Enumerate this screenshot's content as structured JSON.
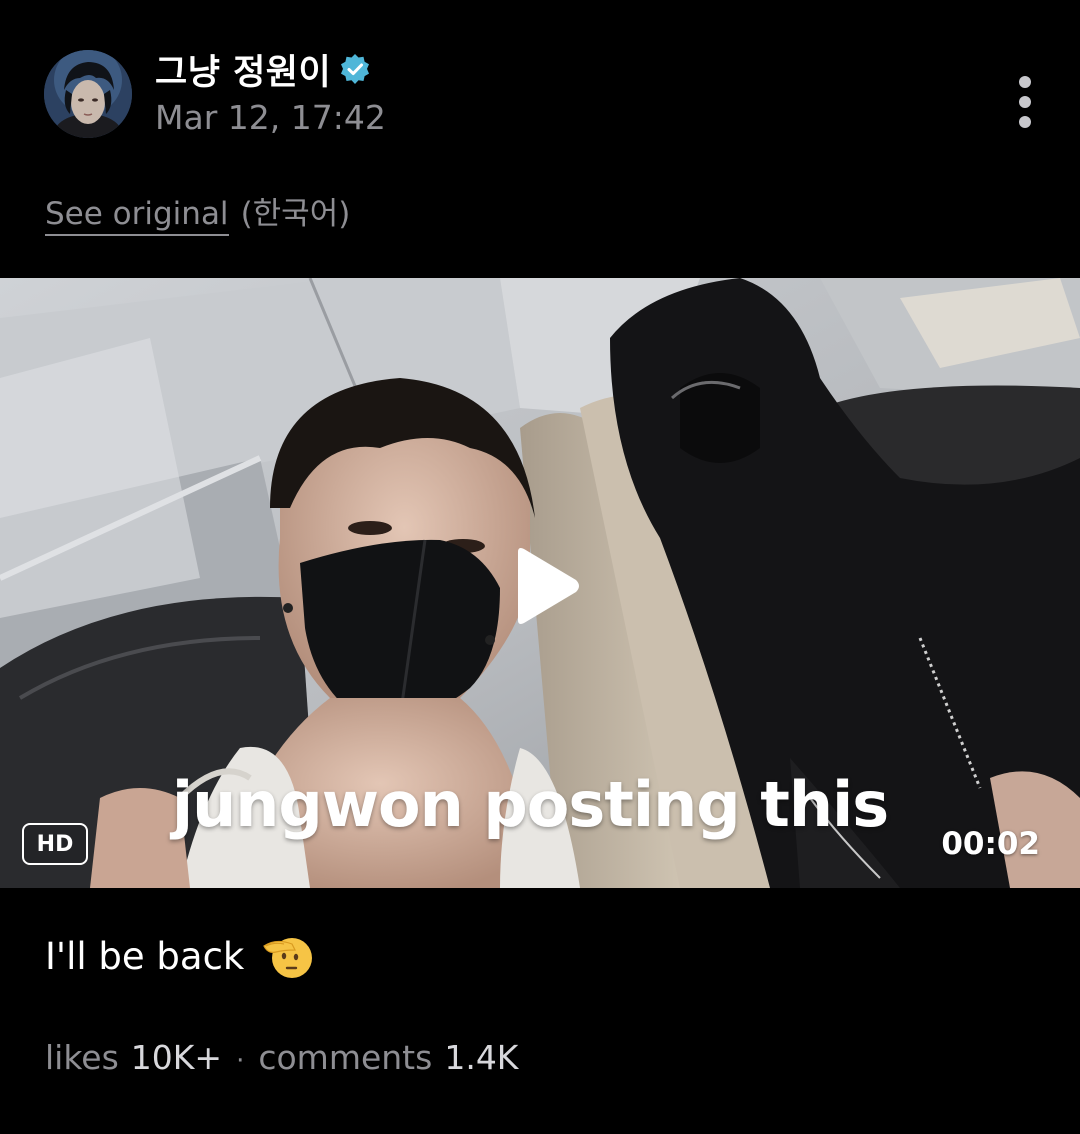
{
  "post": {
    "author_name": "그냥 정원이",
    "verified_icon": "verified-badge-icon",
    "timestamp": "Mar 12, 17:42",
    "more_icon": "more-vertical-icon"
  },
  "translation": {
    "see_original_label": "See original",
    "language_label": "(한국어)"
  },
  "video": {
    "overlay_text": "jungwon posting this",
    "quality_badge": "HD",
    "duration": "00:02",
    "play_icon": "play-icon"
  },
  "caption": {
    "text": "I'll be back",
    "emoji_icon": "saluting-face-icon"
  },
  "stats": {
    "likes_label": "likes",
    "likes_value": "10K+",
    "separator": "·",
    "comments_label": "comments",
    "comments_value": "1.4K"
  },
  "colors": {
    "background": "#000000",
    "muted_text": "#8e8e93",
    "verified_badge": "#4fb6d8"
  }
}
